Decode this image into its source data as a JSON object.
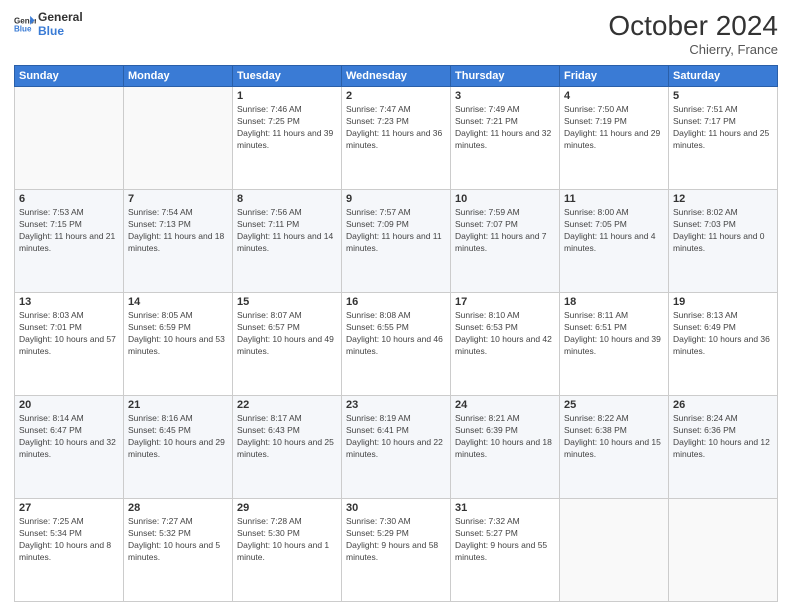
{
  "logo": {
    "line1": "General",
    "line2": "Blue"
  },
  "title": "October 2024",
  "location": "Chierry, France",
  "days_header": [
    "Sunday",
    "Monday",
    "Tuesday",
    "Wednesday",
    "Thursday",
    "Friday",
    "Saturday"
  ],
  "weeks": [
    [
      {
        "day": "",
        "info": ""
      },
      {
        "day": "",
        "info": ""
      },
      {
        "day": "1",
        "info": "Sunrise: 7:46 AM\nSunset: 7:25 PM\nDaylight: 11 hours and 39 minutes."
      },
      {
        "day": "2",
        "info": "Sunrise: 7:47 AM\nSunset: 7:23 PM\nDaylight: 11 hours and 36 minutes."
      },
      {
        "day": "3",
        "info": "Sunrise: 7:49 AM\nSunset: 7:21 PM\nDaylight: 11 hours and 32 minutes."
      },
      {
        "day": "4",
        "info": "Sunrise: 7:50 AM\nSunset: 7:19 PM\nDaylight: 11 hours and 29 minutes."
      },
      {
        "day": "5",
        "info": "Sunrise: 7:51 AM\nSunset: 7:17 PM\nDaylight: 11 hours and 25 minutes."
      }
    ],
    [
      {
        "day": "6",
        "info": "Sunrise: 7:53 AM\nSunset: 7:15 PM\nDaylight: 11 hours and 21 minutes."
      },
      {
        "day": "7",
        "info": "Sunrise: 7:54 AM\nSunset: 7:13 PM\nDaylight: 11 hours and 18 minutes."
      },
      {
        "day": "8",
        "info": "Sunrise: 7:56 AM\nSunset: 7:11 PM\nDaylight: 11 hours and 14 minutes."
      },
      {
        "day": "9",
        "info": "Sunrise: 7:57 AM\nSunset: 7:09 PM\nDaylight: 11 hours and 11 minutes."
      },
      {
        "day": "10",
        "info": "Sunrise: 7:59 AM\nSunset: 7:07 PM\nDaylight: 11 hours and 7 minutes."
      },
      {
        "day": "11",
        "info": "Sunrise: 8:00 AM\nSunset: 7:05 PM\nDaylight: 11 hours and 4 minutes."
      },
      {
        "day": "12",
        "info": "Sunrise: 8:02 AM\nSunset: 7:03 PM\nDaylight: 11 hours and 0 minutes."
      }
    ],
    [
      {
        "day": "13",
        "info": "Sunrise: 8:03 AM\nSunset: 7:01 PM\nDaylight: 10 hours and 57 minutes."
      },
      {
        "day": "14",
        "info": "Sunrise: 8:05 AM\nSunset: 6:59 PM\nDaylight: 10 hours and 53 minutes."
      },
      {
        "day": "15",
        "info": "Sunrise: 8:07 AM\nSunset: 6:57 PM\nDaylight: 10 hours and 49 minutes."
      },
      {
        "day": "16",
        "info": "Sunrise: 8:08 AM\nSunset: 6:55 PM\nDaylight: 10 hours and 46 minutes."
      },
      {
        "day": "17",
        "info": "Sunrise: 8:10 AM\nSunset: 6:53 PM\nDaylight: 10 hours and 42 minutes."
      },
      {
        "day": "18",
        "info": "Sunrise: 8:11 AM\nSunset: 6:51 PM\nDaylight: 10 hours and 39 minutes."
      },
      {
        "day": "19",
        "info": "Sunrise: 8:13 AM\nSunset: 6:49 PM\nDaylight: 10 hours and 36 minutes."
      }
    ],
    [
      {
        "day": "20",
        "info": "Sunrise: 8:14 AM\nSunset: 6:47 PM\nDaylight: 10 hours and 32 minutes."
      },
      {
        "day": "21",
        "info": "Sunrise: 8:16 AM\nSunset: 6:45 PM\nDaylight: 10 hours and 29 minutes."
      },
      {
        "day": "22",
        "info": "Sunrise: 8:17 AM\nSunset: 6:43 PM\nDaylight: 10 hours and 25 minutes."
      },
      {
        "day": "23",
        "info": "Sunrise: 8:19 AM\nSunset: 6:41 PM\nDaylight: 10 hours and 22 minutes."
      },
      {
        "day": "24",
        "info": "Sunrise: 8:21 AM\nSunset: 6:39 PM\nDaylight: 10 hours and 18 minutes."
      },
      {
        "day": "25",
        "info": "Sunrise: 8:22 AM\nSunset: 6:38 PM\nDaylight: 10 hours and 15 minutes."
      },
      {
        "day": "26",
        "info": "Sunrise: 8:24 AM\nSunset: 6:36 PM\nDaylight: 10 hours and 12 minutes."
      }
    ],
    [
      {
        "day": "27",
        "info": "Sunrise: 7:25 AM\nSunset: 5:34 PM\nDaylight: 10 hours and 8 minutes."
      },
      {
        "day": "28",
        "info": "Sunrise: 7:27 AM\nSunset: 5:32 PM\nDaylight: 10 hours and 5 minutes."
      },
      {
        "day": "29",
        "info": "Sunrise: 7:28 AM\nSunset: 5:30 PM\nDaylight: 10 hours and 1 minute."
      },
      {
        "day": "30",
        "info": "Sunrise: 7:30 AM\nSunset: 5:29 PM\nDaylight: 9 hours and 58 minutes."
      },
      {
        "day": "31",
        "info": "Sunrise: 7:32 AM\nSunset: 5:27 PM\nDaylight: 9 hours and 55 minutes."
      },
      {
        "day": "",
        "info": ""
      },
      {
        "day": "",
        "info": ""
      }
    ]
  ]
}
